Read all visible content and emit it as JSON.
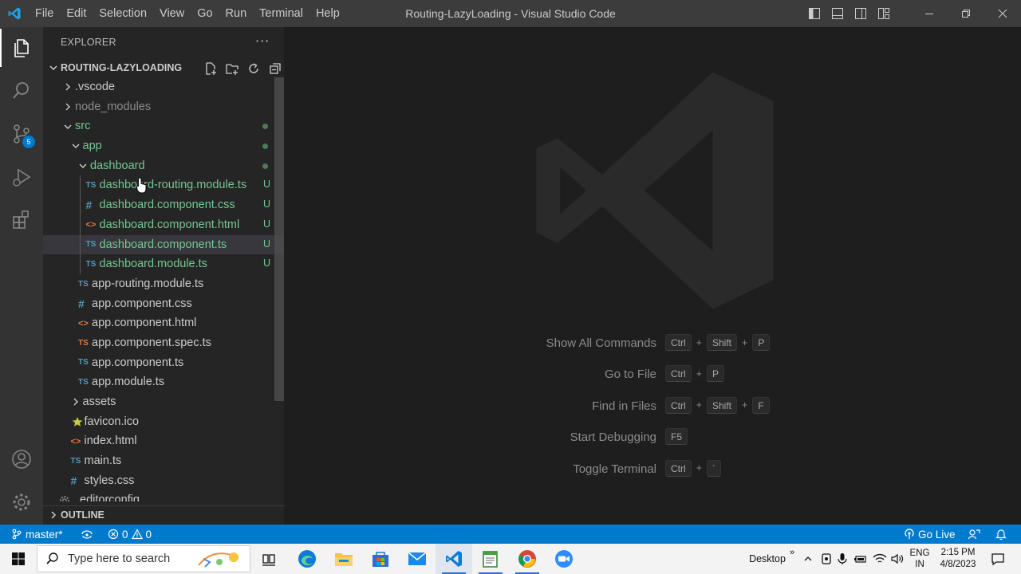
{
  "window": {
    "title": "Routing-LazyLoading - Visual Studio Code",
    "menu": [
      "File",
      "Edit",
      "Selection",
      "View",
      "Go",
      "Run",
      "Terminal",
      "Help"
    ]
  },
  "activity_bar": {
    "source_control_badge": "5"
  },
  "sidebar": {
    "title": "EXPLORER",
    "more": "···",
    "workspace": "ROUTING-LAZYLOADING",
    "outline": "OUTLINE",
    "tree": [
      {
        "name": ".vscode",
        "type": "folder",
        "expanded": false,
        "depth": 0,
        "color": "#cccccc"
      },
      {
        "name": "node_modules",
        "type": "folder",
        "expanded": false,
        "depth": 0,
        "color": "#8c8c8c"
      },
      {
        "name": "src",
        "type": "folder",
        "expanded": true,
        "depth": 0,
        "color": "#73c991",
        "dot": true
      },
      {
        "name": "app",
        "type": "folder",
        "expanded": true,
        "depth": 1,
        "color": "#73c991",
        "dot": true
      },
      {
        "name": "dashboard",
        "type": "folder",
        "expanded": true,
        "depth": 2,
        "color": "#73c991",
        "dot": true
      },
      {
        "name": "dashboard-routing.module.ts",
        "type": "ts",
        "depth": 3,
        "color": "#73c991",
        "status": "U"
      },
      {
        "name": "dashboard.component.css",
        "type": "css",
        "depth": 3,
        "color": "#73c991",
        "status": "U"
      },
      {
        "name": "dashboard.component.html",
        "type": "html",
        "depth": 3,
        "color": "#73c991",
        "status": "U"
      },
      {
        "name": "dashboard.component.ts",
        "type": "ts",
        "depth": 3,
        "color": "#73c991",
        "status": "U",
        "selected": true
      },
      {
        "name": "dashboard.module.ts",
        "type": "ts",
        "depth": 3,
        "color": "#73c991",
        "status": "U"
      },
      {
        "name": "app-routing.module.ts",
        "type": "ts",
        "depth": 2,
        "color": "#cccccc"
      },
      {
        "name": "app.component.css",
        "type": "css",
        "depth": 2,
        "color": "#cccccc"
      },
      {
        "name": "app.component.html",
        "type": "html",
        "depth": 2,
        "color": "#cccccc"
      },
      {
        "name": "app.component.spec.ts",
        "type": "spec",
        "depth": 2,
        "color": "#cccccc"
      },
      {
        "name": "app.component.ts",
        "type": "ts",
        "depth": 2,
        "color": "#cccccc"
      },
      {
        "name": "app.module.ts",
        "type": "ts",
        "depth": 2,
        "color": "#cccccc"
      },
      {
        "name": "assets",
        "type": "folder",
        "expanded": false,
        "depth": 1,
        "color": "#cccccc"
      },
      {
        "name": "favicon.ico",
        "type": "star",
        "depth": 1,
        "color": "#cccccc"
      },
      {
        "name": "index.html",
        "type": "html",
        "depth": 1,
        "color": "#cccccc"
      },
      {
        "name": "main.ts",
        "type": "ts",
        "depth": 1,
        "color": "#cccccc"
      },
      {
        "name": "styles.css",
        "type": "css",
        "depth": 1,
        "color": "#cccccc"
      },
      {
        "name": ".editorconfig",
        "type": "gear",
        "depth": 0,
        "color": "#cccccc"
      }
    ]
  },
  "editor": {
    "shortcuts": [
      {
        "label": "Show All Commands",
        "keys": [
          "Ctrl",
          "Shift",
          "P"
        ]
      },
      {
        "label": "Go to File",
        "keys": [
          "Ctrl",
          "P"
        ]
      },
      {
        "label": "Find in Files",
        "keys": [
          "Ctrl",
          "Shift",
          "F"
        ]
      },
      {
        "label": "Start Debugging",
        "keys": [
          "F5"
        ]
      },
      {
        "label": "Toggle Terminal",
        "keys": [
          "Ctrl",
          "`"
        ]
      }
    ]
  },
  "statusbar": {
    "branch": "master*",
    "errors": "0",
    "warnings": "0",
    "go_live": "Go Live"
  },
  "taskbar": {
    "search_placeholder": "Type here to search",
    "desktop": "Desktop",
    "chevron": "»",
    "lang_top": "ENG",
    "lang_bottom": "IN",
    "time": "2:15 PM",
    "date": "4/8/2023"
  },
  "colors": {
    "accent": "#007acc",
    "ts_icon": "#519aba",
    "css_icon": "#519aba",
    "html_icon": "#e37933",
    "spec_icon": "#e37933",
    "git_untracked": "#73c991"
  }
}
